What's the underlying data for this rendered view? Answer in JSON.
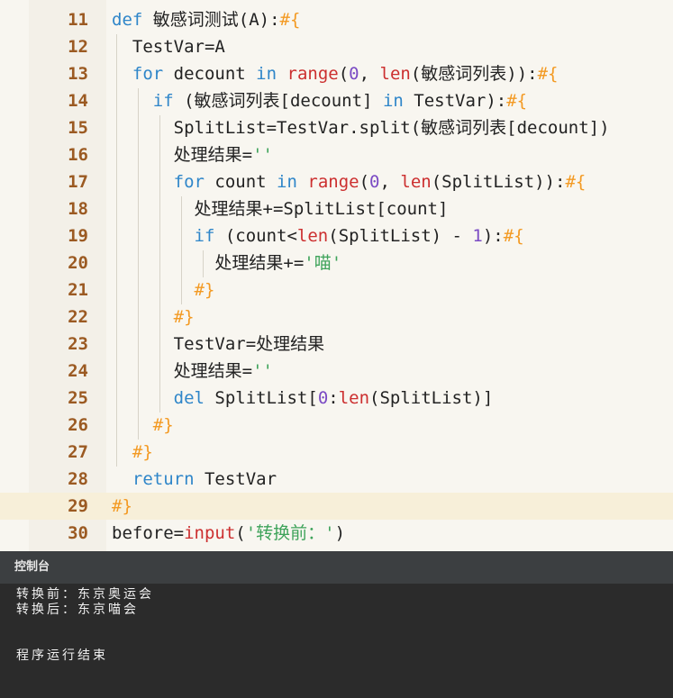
{
  "editor": {
    "current_line_number": "29",
    "lines": [
      {
        "n": "11",
        "tokens": [
          {
            "t": "def ",
            "c": "kw"
          },
          {
            "t": "敏感词测试(A):"
          },
          {
            "t": "#{",
            "c": "mark"
          }
        ]
      },
      {
        "n": "12",
        "tokens": [
          {
            "t": "  TestVar=A"
          }
        ]
      },
      {
        "n": "13",
        "tokens": [
          {
            "t": "  "
          },
          {
            "t": "for",
            "c": "kw"
          },
          {
            "t": " decount "
          },
          {
            "t": "in",
            "c": "kw"
          },
          {
            "t": " "
          },
          {
            "t": "range",
            "c": "fn"
          },
          {
            "t": "("
          },
          {
            "t": "0",
            "c": "num"
          },
          {
            "t": ", "
          },
          {
            "t": "len",
            "c": "fn"
          },
          {
            "t": "(敏感词列表)):"
          },
          {
            "t": "#{",
            "c": "mark"
          }
        ]
      },
      {
        "n": "14",
        "tokens": [
          {
            "t": "    "
          },
          {
            "t": "if",
            "c": "kw"
          },
          {
            "t": " (敏感词列表[decount] "
          },
          {
            "t": "in",
            "c": "kw"
          },
          {
            "t": " TestVar):"
          },
          {
            "t": "#{",
            "c": "mark"
          }
        ]
      },
      {
        "n": "15",
        "tokens": [
          {
            "t": "      SplitList=TestVar.split(敏感词列表[decount])"
          }
        ]
      },
      {
        "n": "16",
        "tokens": [
          {
            "t": "      处理结果="
          },
          {
            "t": "''",
            "c": "str"
          }
        ]
      },
      {
        "n": "17",
        "tokens": [
          {
            "t": "      "
          },
          {
            "t": "for",
            "c": "kw"
          },
          {
            "t": " count "
          },
          {
            "t": "in",
            "c": "kw"
          },
          {
            "t": " "
          },
          {
            "t": "range",
            "c": "fn"
          },
          {
            "t": "("
          },
          {
            "t": "0",
            "c": "num"
          },
          {
            "t": ", "
          },
          {
            "t": "len",
            "c": "fn"
          },
          {
            "t": "(SplitList)):"
          },
          {
            "t": "#{",
            "c": "mark"
          }
        ]
      },
      {
        "n": "18",
        "tokens": [
          {
            "t": "        处理结果+=SplitList[count]"
          }
        ]
      },
      {
        "n": "19",
        "tokens": [
          {
            "t": "        "
          },
          {
            "t": "if",
            "c": "kw"
          },
          {
            "t": " (count<"
          },
          {
            "t": "len",
            "c": "fn"
          },
          {
            "t": "(SplitList) - "
          },
          {
            "t": "1",
            "c": "num"
          },
          {
            "t": "):"
          },
          {
            "t": "#{",
            "c": "mark"
          }
        ]
      },
      {
        "n": "20",
        "tokens": [
          {
            "t": "          处理结果+="
          },
          {
            "t": "'喵'",
            "c": "str"
          }
        ]
      },
      {
        "n": "21",
        "tokens": [
          {
            "t": "        "
          },
          {
            "t": "#}",
            "c": "mark"
          }
        ]
      },
      {
        "n": "22",
        "tokens": [
          {
            "t": "      "
          },
          {
            "t": "#}",
            "c": "mark"
          }
        ]
      },
      {
        "n": "23",
        "tokens": [
          {
            "t": "      TestVar=处理结果"
          }
        ]
      },
      {
        "n": "24",
        "tokens": [
          {
            "t": "      处理结果="
          },
          {
            "t": "''",
            "c": "str"
          }
        ]
      },
      {
        "n": "25",
        "tokens": [
          {
            "t": "      "
          },
          {
            "t": "del",
            "c": "kw"
          },
          {
            "t": " SplitList["
          },
          {
            "t": "0",
            "c": "num"
          },
          {
            "t": ":"
          },
          {
            "t": "len",
            "c": "fn"
          },
          {
            "t": "(SplitList)]"
          }
        ]
      },
      {
        "n": "26",
        "tokens": [
          {
            "t": "    "
          },
          {
            "t": "#}",
            "c": "mark"
          }
        ]
      },
      {
        "n": "27",
        "tokens": [
          {
            "t": "  "
          },
          {
            "t": "#}",
            "c": "mark"
          }
        ]
      },
      {
        "n": "28",
        "tokens": [
          {
            "t": "  "
          },
          {
            "t": "return",
            "c": "kw"
          },
          {
            "t": " TestVar"
          }
        ]
      },
      {
        "n": "29",
        "tokens": [
          {
            "t": "#}",
            "c": "mark"
          }
        ]
      },
      {
        "n": "30",
        "tokens": [
          {
            "t": "before="
          },
          {
            "t": "input",
            "c": "fn"
          },
          {
            "t": "("
          },
          {
            "t": "'转换前：'",
            "c": "str"
          },
          {
            "t": ")"
          }
        ]
      }
    ]
  },
  "console": {
    "title": "控制台",
    "output": [
      "转换前：东京奥运会",
      "转换后：东京喵会",
      "",
      "",
      "程序运行结束"
    ]
  }
}
